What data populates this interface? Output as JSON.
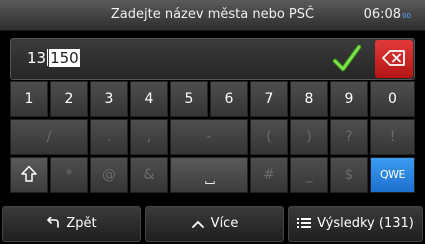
{
  "status_bar": {
    "title": "Zadejte název města nebo PSČ",
    "time": "06:08",
    "seconds": "00"
  },
  "input": {
    "typed": "13",
    "suggested": "150"
  },
  "keyboard": {
    "row1": [
      "1",
      "2",
      "3",
      "4",
      "5",
      "6",
      "7",
      "8",
      "9",
      "0"
    ],
    "row2": [
      "/",
      ".",
      ",",
      "-",
      "(",
      ")",
      "?",
      "!"
    ],
    "row3": [
      "*",
      "@",
      "&",
      "#",
      "_",
      "$",
      "€"
    ],
    "qwe_label": "QWE"
  },
  "bottom_bar": {
    "back_label": "Zpět",
    "more_label": "Více",
    "results_label": "Výsledky (131)"
  },
  "colors": {
    "confirm_check": "#6fd13a",
    "backspace": "#d42a2a",
    "qwe_key": "#2c86e3",
    "clock_seconds": "#57a8ff"
  },
  "icons": {
    "confirm": "checkmark-icon",
    "backspace": "backspace-icon",
    "shift": "shift-arrow-icon",
    "space": "space-icon",
    "back": "back-arrow-icon",
    "more": "chevron-up-icon",
    "results": "list-icon"
  }
}
